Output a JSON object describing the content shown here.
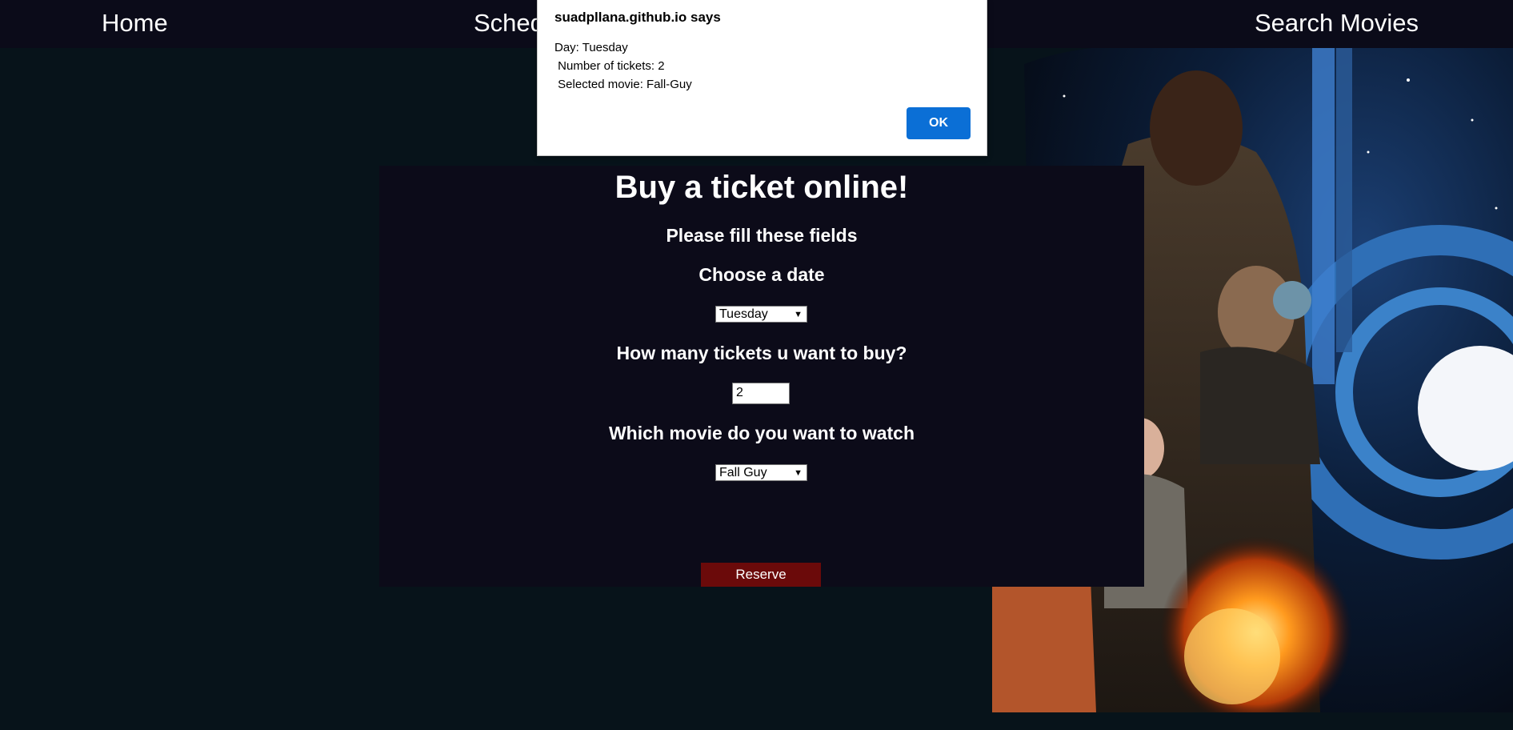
{
  "nav": {
    "home": "Home",
    "schedule": "Sched",
    "search": "Search Movies"
  },
  "alert": {
    "title": "suadpllana.github.io says",
    "message": "Day: Tuesday\n Number of tickets: 2\n Selected movie: Fall-Guy",
    "ok": "OK"
  },
  "form": {
    "heading": "Buy a ticket online!",
    "subheading": "Please fill these fields",
    "date_label": "Choose a date",
    "date_value": "Tuesday",
    "tickets_label": "How many tickets u want to buy?",
    "tickets_value": "2",
    "movie_label": "Which movie do you want to watch",
    "movie_value": "Fall Guy",
    "reserve": "Reserve"
  },
  "colors": {
    "page_bg": "#07131a",
    "nav_bg": "#0b0b19",
    "panel_bg": "#0c0b19",
    "reserve_bg": "#6b0a0a",
    "ok_button": "#0b6fd6"
  }
}
